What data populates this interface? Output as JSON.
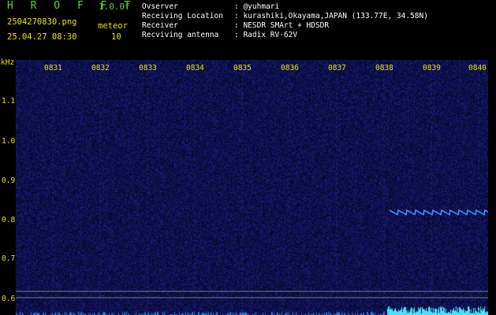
{
  "header": {
    "brand": "H R O F F T",
    "version": "1.0.0f",
    "filename": "2504270830.png",
    "datetime": "25.04.27 08:30",
    "mode": "meteor",
    "count": "10"
  },
  "info": [
    {
      "label": "Ovserver",
      "value": ": @yuhmari"
    },
    {
      "label": "Receiving Location",
      "value": ": kurashiki,Okayama,JAPAN (133.77E, 34.58N)"
    },
    {
      "label": "Receiver",
      "value": ": NESDR SMArt + HDSDR"
    },
    {
      "label": "Recviving antenna",
      "value": ": Radix RV-62V"
    }
  ],
  "axes": {
    "y_unit": "kHz",
    "y_ticks": [
      "1.1",
      "1.0",
      "0.9",
      "0.8",
      "0.7",
      "0.6"
    ],
    "x_ticks": [
      "0831",
      "0832",
      "0833",
      "0834",
      "0835",
      "0836",
      "0837",
      "0838",
      "0839",
      "0840"
    ]
  },
  "colors": {
    "label": "#e8e000",
    "brand": "#5fcf3f",
    "signal": "#3a90ff",
    "baseline": "#4ae0ff"
  }
}
